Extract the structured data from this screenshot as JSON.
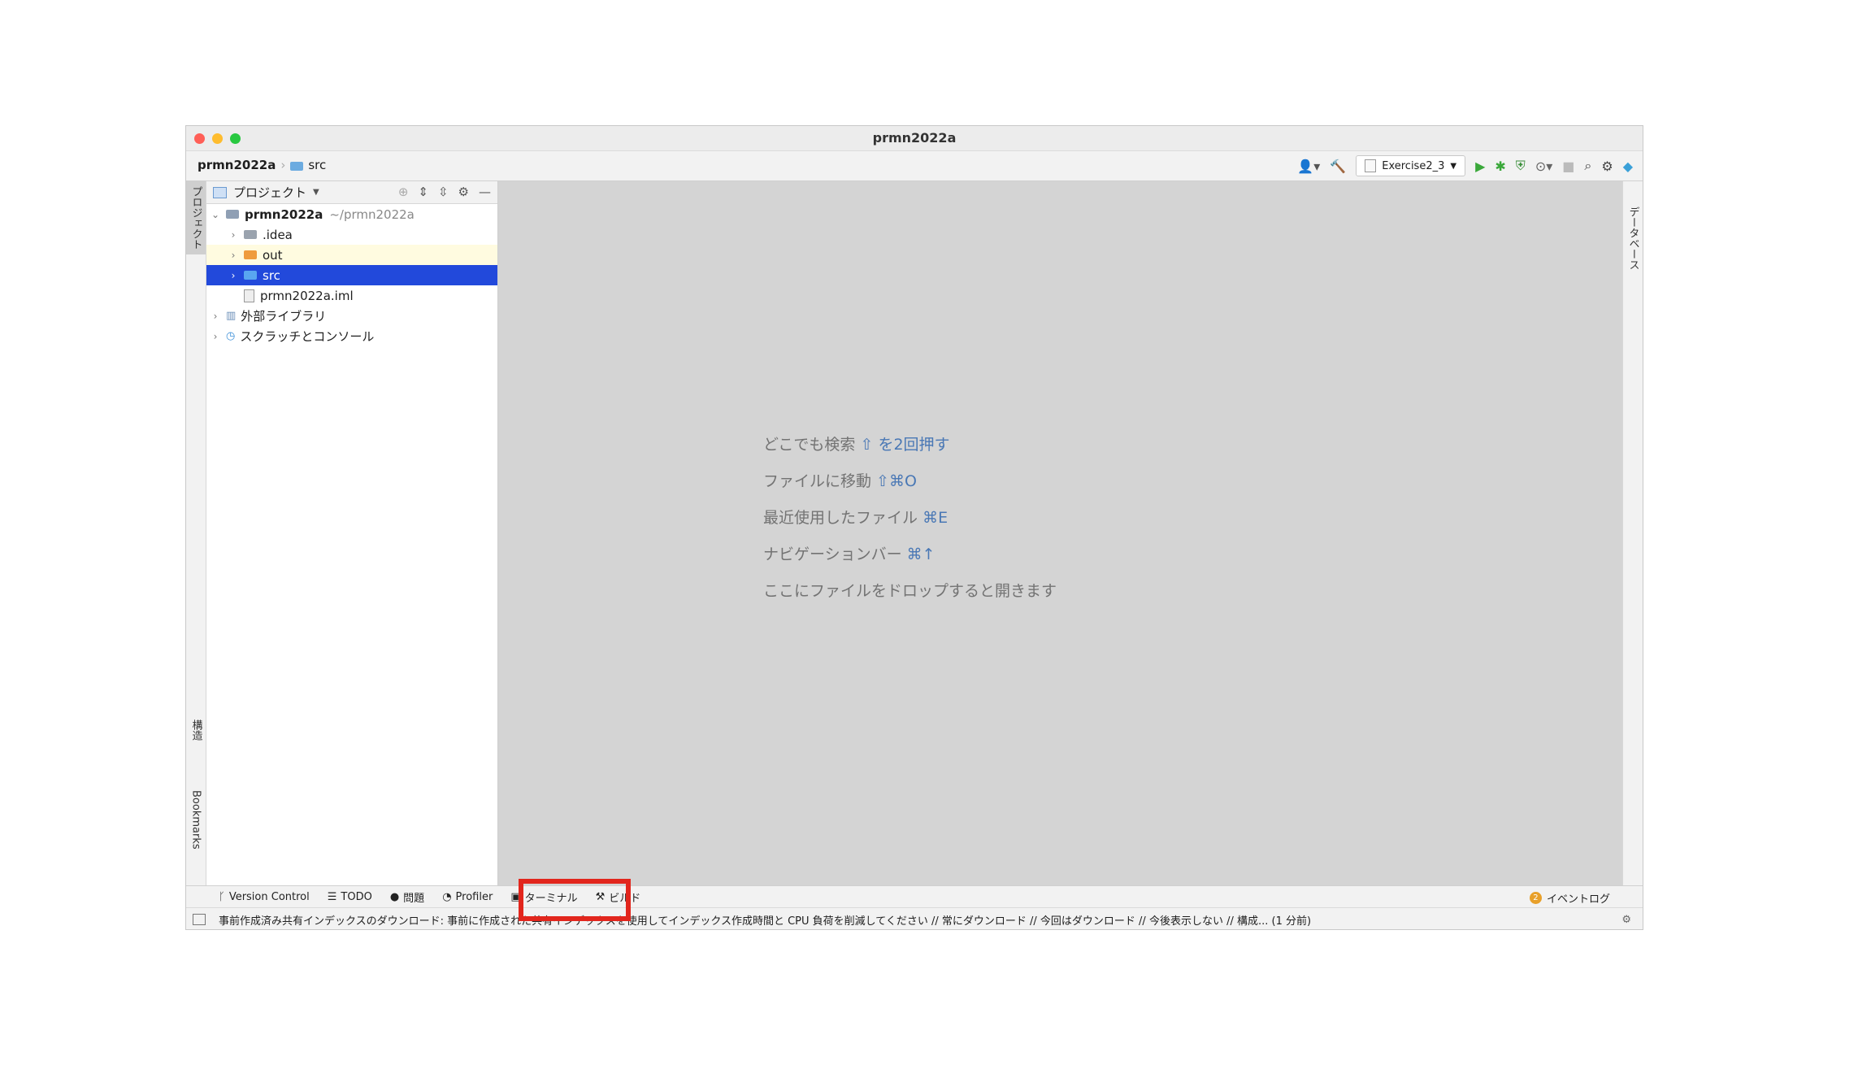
{
  "window": {
    "title": "prmn2022a"
  },
  "breadcrumb": {
    "project": "prmn2022a",
    "folder": "src"
  },
  "toolbar": {
    "run_config": "Exercise2_3",
    "icons": [
      "user-icon",
      "build-hammer-icon",
      "run-icon",
      "debug-icon",
      "coverage-icon",
      "profile-icon",
      "stop-icon",
      "search-icon",
      "settings-icon",
      "plugin-icon"
    ]
  },
  "left_strip": {
    "project_tab": "プロジェクト",
    "structure_tab": "構造",
    "bookmarks_tab": "Bookmarks"
  },
  "right_strip": {
    "database_tab": "データベース"
  },
  "project_panel": {
    "title": "プロジェクト",
    "root": {
      "name": "prmn2022a",
      "path": "~/prmn2022a"
    },
    "items": [
      {
        "label": ".idea"
      },
      {
        "label": "out"
      },
      {
        "label": "src"
      },
      {
        "label": "prmn2022a.iml"
      },
      {
        "label": "外部ライブラリ"
      },
      {
        "label": "スクラッチとコンソール"
      }
    ]
  },
  "editor_hints": [
    {
      "text": "どこでも検索",
      "key": "⇧ を2回押す"
    },
    {
      "text": "ファイルに移動",
      "key": "⇧⌘O"
    },
    {
      "text": "最近使用したファイル",
      "key": "⌘E"
    },
    {
      "text": "ナビゲーションバー",
      "key": "⌘↑"
    },
    {
      "text": "ここにファイルをドロップすると開きます",
      "key": ""
    }
  ],
  "bottom_tabs": [
    {
      "label": "Version Control"
    },
    {
      "label": "TODO"
    },
    {
      "label": "問題"
    },
    {
      "label": "Profiler"
    },
    {
      "label": "ターミナル"
    },
    {
      "label": "ビルド"
    }
  ],
  "event_log": {
    "label": "イベントログ",
    "count": "2"
  },
  "status": {
    "message": "事前作成済み共有インデックスのダウンロード: 事前に作成された共有インデックスを使用してインデックス作成時間と CPU 負荷を削減してください // 常にダウンロード // 今回はダウンロード // 今後表示しない // 構成... (1 分前)"
  },
  "colors": {
    "selection": "#2249db",
    "highlight_box": "#e2261d",
    "hint_key": "#4a78b5"
  }
}
